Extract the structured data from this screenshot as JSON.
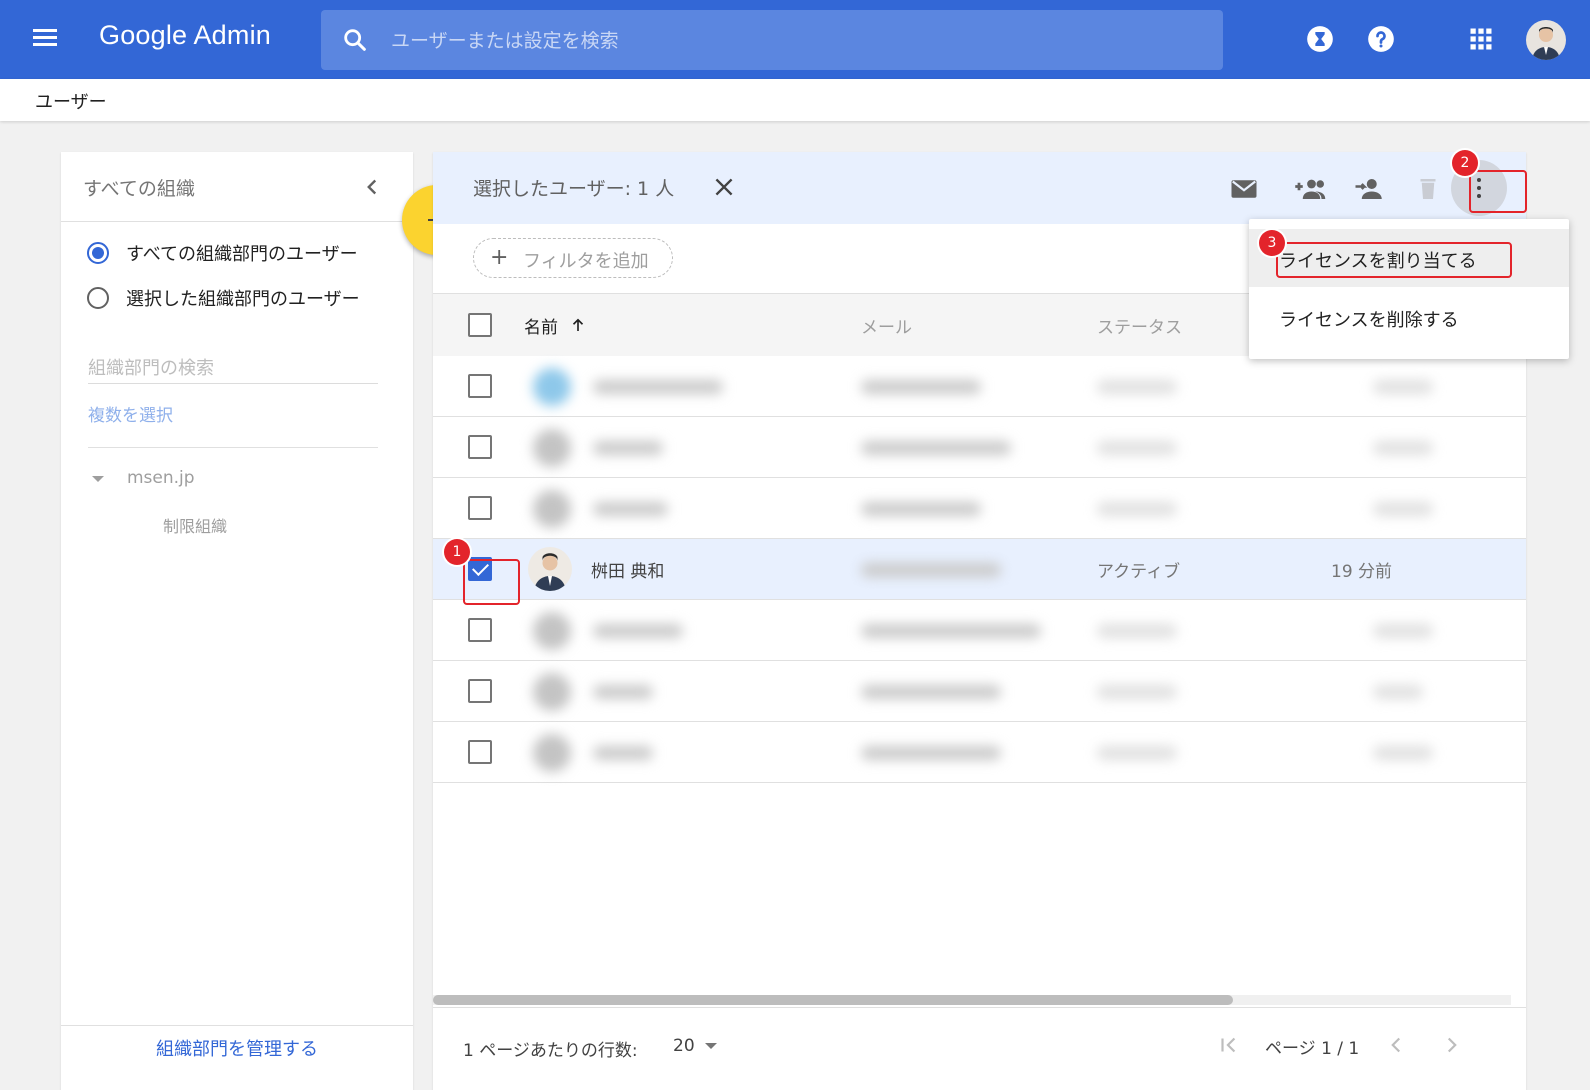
{
  "header": {
    "logo_text": "Google Admin",
    "search_placeholder": "ユーザーまたは設定を検索"
  },
  "icons": {
    "menu": "menu-icon",
    "search": "search-icon",
    "hourglass": "hourglass-icon",
    "help": "help-icon",
    "apps": "apps-grid-icon",
    "avatar": "avatar"
  },
  "breadcrumb": "ユーザー",
  "org_panel": {
    "title": "すべての組織",
    "options": [
      {
        "label": "すべての組織部門のユーザー",
        "selected": true
      },
      {
        "label": "選択した組織部門のユーザー",
        "selected": false
      }
    ],
    "search_placeholder": "組織部門の検索",
    "multi_select": "複数を選択",
    "tree_root": "msen.jp",
    "tree_child": "制限組織",
    "manage_link": "組織部門を管理する"
  },
  "selection_bar": {
    "text": "選択したユーザー: 1 人"
  },
  "filter": {
    "add_label": "フィルタを追加"
  },
  "table": {
    "columns": [
      "名前",
      "メール",
      "ステータス"
    ],
    "selected_row": {
      "name": "桝田 典和",
      "status": "アクティブ",
      "last_login": "19 分前"
    }
  },
  "menu": {
    "items": [
      "ライセンスを割り当てる",
      "ライセンスを削除する"
    ]
  },
  "pagination": {
    "rows_per_page_label": "1 ページあたりの行数:",
    "rows_per_page_value": "20",
    "page_label": "ページ 1 / 1"
  },
  "annotations": {
    "badge_1": "1",
    "badge_2": "2",
    "badge_3": "3",
    "color": "#e3242b"
  },
  "colors": {
    "brand_blue": "#3367d6",
    "fab_yellow": "#fbd32f",
    "selection_bg": "#e8f0fe"
  }
}
